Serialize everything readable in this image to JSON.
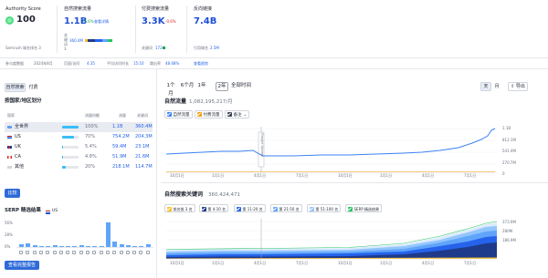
{
  "top_metrics": {
    "authority": {
      "label": "Authority Score",
      "value": "100",
      "sub": "Semrush 域名排名 3"
    },
    "organic": {
      "label": "自然搜索流量",
      "value": "1.1B",
      "change": "+1.6%",
      "link": "查看详情",
      "kw_prefix": "关键词",
      "kw_value": "360.4M",
      "kw_rank": "3"
    },
    "paid": {
      "label": "付费搜索流量",
      "value": "3.3K",
      "change": "-0.6%",
      "kw_label": "关键词",
      "kw_value": "172"
    },
    "backlinks": {
      "label": "反向链接",
      "value": "7.4B",
      "ref_label": "引用域名",
      "ref_value": "2.5M"
    }
  },
  "visits_bar": {
    "ref_label": "参与度数据",
    "ref_date": "2024年8月",
    "pages_label": "页面/访问",
    "pages_value": "4.35",
    "duration_label": "平均访问时长",
    "duration_value": "15:10",
    "bounce_label": "跳出率",
    "bounce_value": "48.68%",
    "traffic_link": "流量分析",
    "competitors_link": "查看趋势"
  },
  "left": {
    "toggle": [
      "自然搜索",
      "付费"
    ],
    "region_title": "按国家/地区划分",
    "table_headers": [
      "国家",
      "流量份额",
      "流量",
      "关键词"
    ],
    "rows": [
      {
        "flag": "world",
        "name": "全世界",
        "share_pct": 100,
        "share": "100%",
        "traffic": "1.1B",
        "keywords": "360.4M",
        "selected": true
      },
      {
        "flag": "us",
        "name": "US",
        "share_pct": 70,
        "share": "70%",
        "traffic": "754.2M",
        "keywords": "204.3M",
        "selected": false
      },
      {
        "flag": "uk",
        "name": "UK",
        "share_pct": 5.4,
        "share": "5.4%",
        "traffic": "59.4M",
        "keywords": "23.1M",
        "selected": false
      },
      {
        "flag": "ca",
        "name": "CA",
        "share_pct": 4.8,
        "share": "4.8%",
        "traffic": "51.9M",
        "keywords": "21.6M",
        "selected": false
      },
      {
        "flag": "other",
        "name": "其他",
        "share_pct": 20,
        "share": "20%",
        "traffic": "218.1M",
        "keywords": "114.7M",
        "selected": false
      }
    ],
    "compare_button": "比较",
    "serp": {
      "title": "SERP 精选结果",
      "country": "US",
      "y_labels": [
        "56%",
        "28%",
        "0%"
      ],
      "bars": [
        6,
        9,
        4,
        3,
        2,
        5,
        3,
        2,
        2,
        4,
        3,
        2,
        2,
        54,
        13,
        7,
        4,
        3,
        2,
        6
      ],
      "report_button": "查看完整报告"
    }
  },
  "right": {
    "ranges": [
      "1个月",
      "6个月",
      "1年",
      "2年",
      "全部时间"
    ],
    "active_range": "2年",
    "granularity": [
      "天",
      "月"
    ],
    "export_label": "导出",
    "traffic_chart": {
      "title": "自然流量",
      "total": "1,082,195,217/月",
      "legend": [
        "自然流量",
        "付费流量",
        "备注"
      ],
      "annotation": "Google Update",
      "y_labels": [
        "1.1B",
        "812.1M",
        "541.4M",
        "270.7M",
        "0"
      ],
      "x_labels": [
        "10月1日",
        "1月1日",
        "4月1日",
        "7月1日",
        "10月1日",
        "1月1日",
        "4月1日",
        "7月1日"
      ]
    },
    "keywords_chart": {
      "title": "自然搜索关键词",
      "total": "360,424,471",
      "legend": [
        "排名前 3 名",
        "第 4-10 名",
        "第 11-20 名",
        "第 21-50 名",
        "第 51-100 名",
        "SERP 精选结果"
      ],
      "legend_colors": [
        "#fbbf24",
        "#1e3a8a",
        "#2563eb",
        "#60a5fa",
        "#93c5fd",
        "#22c55e"
      ],
      "y_labels": [
        "373.9M",
        "280M",
        "186.9M"
      ],
      "x_labels": [
        "10月1日",
        "1月1日",
        "4月1日",
        "7月1日",
        "10月1日",
        "1月1日",
        "4月1日",
        "7月1日"
      ]
    }
  },
  "colors": {
    "accent": "#2563eb",
    "organic": "#3b82f6",
    "paid": "#f59e0b"
  }
}
